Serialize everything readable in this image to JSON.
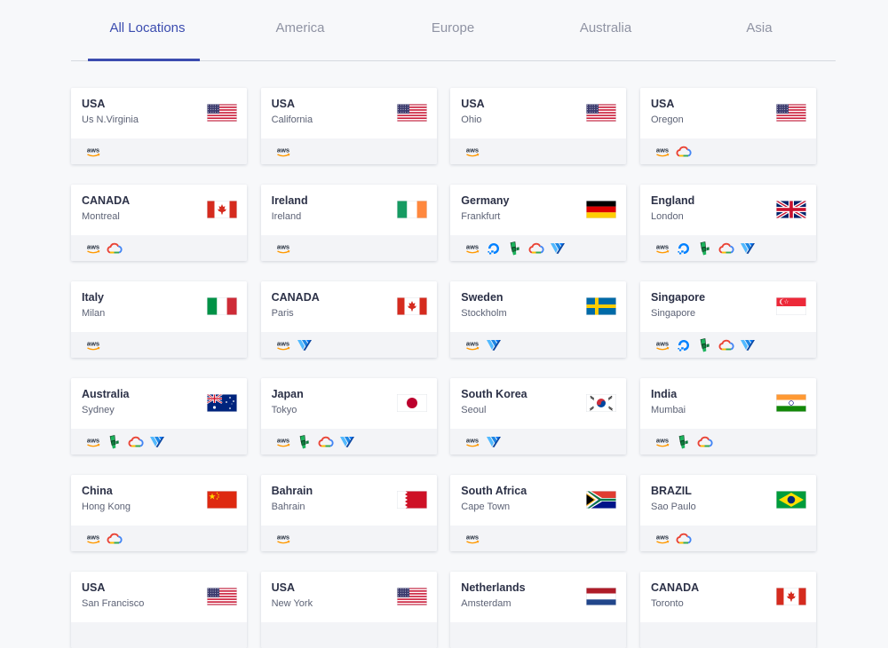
{
  "tabs": [
    {
      "label": "All Locations",
      "active": true
    },
    {
      "label": "America",
      "active": false
    },
    {
      "label": "Europe",
      "active": false
    },
    {
      "label": "Australia",
      "active": false
    },
    {
      "label": "Asia",
      "active": false
    }
  ],
  "colors": {
    "accent": "#3b4caf",
    "tab_inactive": "#8f93a3",
    "card_footer": "#f3f4f7",
    "background": "#f7f8fa"
  },
  "locations": [
    {
      "country": "USA",
      "city": "Us N.Virginia",
      "flag": "us",
      "providers": [
        "aws-icon"
      ]
    },
    {
      "country": "USA",
      "city": "California",
      "flag": "us",
      "providers": [
        "aws-icon"
      ]
    },
    {
      "country": "USA",
      "city": "Ohio",
      "flag": "us",
      "providers": [
        "aws-icon"
      ]
    },
    {
      "country": "USA",
      "city": "Oregon",
      "flag": "us",
      "providers": [
        "aws-icon",
        "google-cloud-icon"
      ]
    },
    {
      "country": "CANADA",
      "city": "Montreal",
      "flag": "ca",
      "providers": [
        "aws-icon",
        "google-cloud-icon"
      ]
    },
    {
      "country": "Ireland",
      "city": "Ireland",
      "flag": "ie",
      "providers": [
        "aws-icon"
      ]
    },
    {
      "country": "Germany",
      "city": "Frankfurt",
      "flag": "de",
      "providers": [
        "aws-icon",
        "digitalocean-icon",
        "linode-icon",
        "google-cloud-icon",
        "vultr-icon"
      ]
    },
    {
      "country": "England",
      "city": "London",
      "flag": "gb",
      "providers": [
        "aws-icon",
        "digitalocean-icon",
        "linode-icon",
        "google-cloud-icon",
        "vultr-icon"
      ]
    },
    {
      "country": "Italy",
      "city": "Milan",
      "flag": "it",
      "providers": [
        "aws-icon"
      ]
    },
    {
      "country": "CANADA",
      "city": "Paris",
      "flag": "ca",
      "providers": [
        "aws-icon",
        "vultr-icon"
      ]
    },
    {
      "country": "Sweden",
      "city": "Stockholm",
      "flag": "se",
      "providers": [
        "aws-icon",
        "vultr-icon"
      ]
    },
    {
      "country": "Singapore",
      "city": "Singapore",
      "flag": "sg",
      "providers": [
        "aws-icon",
        "digitalocean-icon",
        "linode-icon",
        "google-cloud-icon",
        "vultr-icon"
      ]
    },
    {
      "country": "Australia",
      "city": "Sydney",
      "flag": "au",
      "providers": [
        "aws-icon",
        "linode-icon",
        "google-cloud-icon",
        "vultr-icon"
      ]
    },
    {
      "country": "Japan",
      "city": "Tokyo",
      "flag": "jp",
      "providers": [
        "aws-icon",
        "linode-icon",
        "google-cloud-icon",
        "vultr-icon"
      ]
    },
    {
      "country": "South Korea",
      "city": "Seoul",
      "flag": "kr",
      "providers": [
        "aws-icon",
        "vultr-icon"
      ]
    },
    {
      "country": "India",
      "city": "Mumbai",
      "flag": "in",
      "providers": [
        "aws-icon",
        "linode-icon",
        "google-cloud-icon"
      ]
    },
    {
      "country": "China",
      "city": "Hong Kong",
      "flag": "cn",
      "providers": [
        "aws-icon",
        "google-cloud-icon"
      ]
    },
    {
      "country": "Bahrain",
      "city": "Bahrain",
      "flag": "bh",
      "providers": [
        "aws-icon"
      ]
    },
    {
      "country": "South Africa",
      "city": "Cape Town",
      "flag": "za",
      "providers": [
        "aws-icon"
      ]
    },
    {
      "country": "BRAZIL",
      "city": "Sao Paulo",
      "flag": "br",
      "providers": [
        "aws-icon",
        "google-cloud-icon"
      ]
    },
    {
      "country": "USA",
      "city": "San Francisco",
      "flag": "us",
      "providers": []
    },
    {
      "country": "USA",
      "city": "New York",
      "flag": "us",
      "providers": []
    },
    {
      "country": "Netherlands",
      "city": "Amsterdam",
      "flag": "nl",
      "providers": []
    },
    {
      "country": "CANADA",
      "city": "Toronto",
      "flag": "ca",
      "providers": []
    }
  ]
}
